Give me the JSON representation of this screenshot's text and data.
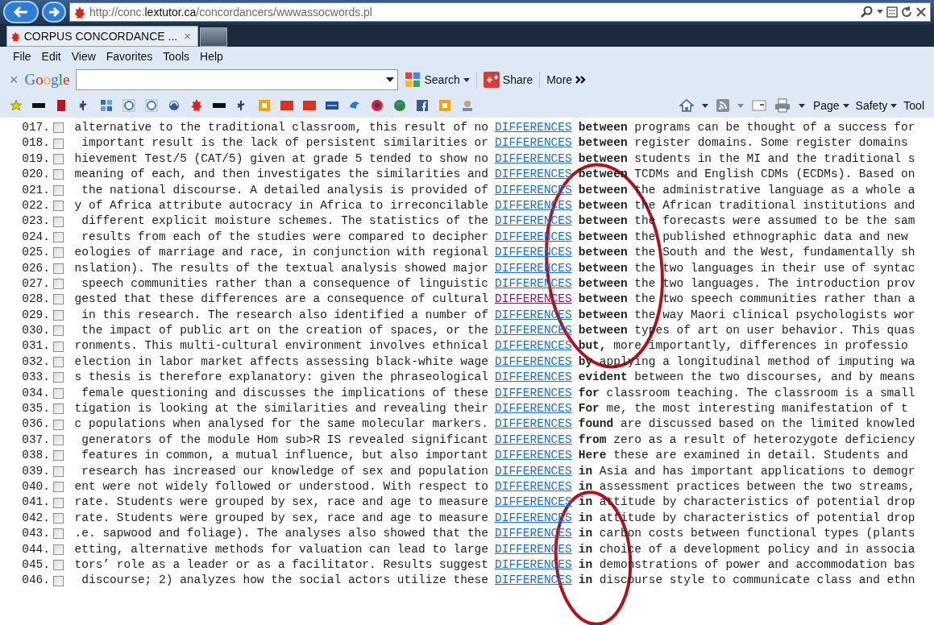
{
  "address_bar": {
    "url": "http://conc.**lextutor.ca**/concordancers/wwwassocwords.pl"
  },
  "tab": {
    "title": "CORPUS CONCORDANCE ...",
    "close": "×"
  },
  "menu": [
    "File",
    "Edit",
    "View",
    "Favorites",
    "Tools",
    "Help"
  ],
  "google_toolbar": {
    "close": "×",
    "logo": "Google",
    "search_button": "Search",
    "share_button": "Share",
    "more_button": "More"
  },
  "command_bar": [
    "Page",
    "Safety",
    "Tool"
  ],
  "rows": [
    {
      "num": "017.",
      "checked": false,
      "left": "alternative to the traditional classroom, this result of no",
      "keyword": "DIFFERENCES",
      "visited": false,
      "right": "**between** programs can be thought of a success for"
    },
    {
      "num": "018.",
      "checked": false,
      "left": " important result is the lack of persistent similarities or",
      "keyword": "DIFFERENCES",
      "visited": false,
      "right": "**between** register domains. Some register domains"
    },
    {
      "num": "019.",
      "checked": false,
      "left": "hievement Test/5 (CAT/5) given at grade 5 tended to show no",
      "keyword": "DIFFERENCES",
      "visited": false,
      "right": "**between** students in the MI and the traditional s"
    },
    {
      "num": "020.",
      "checked": false,
      "left": "meaning of each, and then investigates the similarities and",
      "keyword": "DIFFERENCES",
      "visited": false,
      "right": "**between** TCDMs and English CDMs (ECDMs). Based on"
    },
    {
      "num": "021.",
      "checked": false,
      "left": " the national discourse. A detailed analysis is provided of",
      "keyword": "DIFFERENCES",
      "visited": false,
      "right": "**between** the administrative language as a whole a"
    },
    {
      "num": "022.",
      "checked": false,
      "left": "y of Africa attribute autocracy in Africa to irreconcilable",
      "keyword": "DIFFERENCES",
      "visited": false,
      "right": "**between** the African traditional institutions and"
    },
    {
      "num": "023.",
      "checked": false,
      "left": " different explicit moisture schemes. The statistics of the",
      "keyword": "DIFFERENCES",
      "visited": false,
      "right": "**between** the forecasts were assumed to be the sam"
    },
    {
      "num": "024.",
      "checked": false,
      "left": " results from each of the studies were compared to decipher",
      "keyword": "DIFFERENCES",
      "visited": false,
      "right": "**between** the published ethnographic data and new"
    },
    {
      "num": "025.",
      "checked": false,
      "left": "eologies of marriage and race, in conjunction with regional",
      "keyword": "DIFFERENCES",
      "visited": false,
      "right": "**between** the South and the West, fundamentally sh"
    },
    {
      "num": "026.",
      "checked": false,
      "left": "nslation). The results of the textual analysis showed major",
      "keyword": "DIFFERENCES",
      "visited": false,
      "right": "**between** the two languages in their use of syntac"
    },
    {
      "num": "027.",
      "checked": false,
      "left": " speech communities rather than a consequence of linguistic",
      "keyword": "DIFFERENCES",
      "visited": false,
      "right": "**between** the two languages. The introduction prov"
    },
    {
      "num": "028.",
      "checked": false,
      "left": "gested that these differences are a consequence of cultural",
      "keyword": "DIFFERENCES",
      "visited": true,
      "right": "**between** the two speech communities rather than a"
    },
    {
      "num": "029.",
      "checked": false,
      "left": " in this research. The research also identified a number of",
      "keyword": "DIFFERENCES",
      "visited": false,
      "right": "**between** the way Maori clinical psychologists wor"
    },
    {
      "num": "030.",
      "checked": false,
      "left": " the impact of public art on the creation of spaces, or the",
      "keyword": "DIFFERENCES",
      "visited": false,
      "right": "**between** types of art on user behavior. This quas"
    },
    {
      "num": "031.",
      "checked": false,
      "left": "ronments. This multi-cultural environment involves ethnical",
      "keyword": "DIFFERENCES",
      "visited": false,
      "right": "**but,** more importantly, differences in professio"
    },
    {
      "num": "032.",
      "checked": false,
      "left": "election in labor market affects assessing black-white wage",
      "keyword": "DIFFERENCES",
      "visited": false,
      "right": "**by** applying a longitudinal method of imputing wa"
    },
    {
      "num": "033.",
      "checked": false,
      "left": "s thesis is therefore explanatory: given the phraseological",
      "keyword": "DIFFERENCES",
      "visited": false,
      "right": "**evident** between the two discourses, and by means"
    },
    {
      "num": "034.",
      "checked": false,
      "left": " female questioning and discusses the implications of these",
      "keyword": "DIFFERENCES",
      "visited": false,
      "right": "**for** classroom teaching. The classroom is a small"
    },
    {
      "num": "035.",
      "checked": false,
      "left": "tigation is looking at the similarities and revealing their",
      "keyword": "DIFFERENCES",
      "visited": false,
      "right": "**For** me, the most interesting manifestation of t"
    },
    {
      "num": "036.",
      "checked": false,
      "left": "c populations when analysed for the same molecular markers.",
      "keyword": "DIFFERENCES",
      "visited": false,
      "right": "**found** are discussed based on the limited knowled"
    },
    {
      "num": "037.",
      "checked": false,
      "left": " generators of the module Hom sub>R IS revealed significant",
      "keyword": "DIFFERENCES",
      "visited": false,
      "right": "**from** zero as a result of heterozygote deficiency"
    },
    {
      "num": "038.",
      "checked": false,
      "left": " features in common, a mutual influence, but also important",
      "keyword": "DIFFERENCES",
      "visited": false,
      "right": "**Here** these are examined in detail. Students and"
    },
    {
      "num": "039.",
      "checked": false,
      "left": " research has increased our knowledge of sex and population",
      "keyword": "DIFFERENCES",
      "visited": false,
      "right": "**in** Asia and has important applications to demogr"
    },
    {
      "num": "040.",
      "checked": false,
      "left": "ent were not widely followed or understood. With respect to",
      "keyword": "DIFFERENCES",
      "visited": false,
      "right": "**in** assessment practices between the two streams,"
    },
    {
      "num": "041.",
      "checked": false,
      "left": "rate. Students were grouped by sex, race and age to measure",
      "keyword": "DIFFERENCES",
      "visited": false,
      "right": "**in** attitude by characteristics of potential drop"
    },
    {
      "num": "042.",
      "checked": false,
      "left": "rate. Students were grouped by sex, race and age to measure",
      "keyword": "DIFFERENCES",
      "visited": false,
      "right": "**in** attitude by characteristics of potential drop"
    },
    {
      "num": "043.",
      "checked": false,
      "left": ".e. sapwood and foliage). The analyses also showed that the",
      "keyword": "DIFFERENCES",
      "visited": false,
      "right": "**in** carbon costs between functional types (plants"
    },
    {
      "num": "044.",
      "checked": false,
      "left": "etting, alternative methods for valuation can lead to large",
      "keyword": "DIFFERENCES",
      "visited": false,
      "right": "**in** choice of a development policy and in associa"
    },
    {
      "num": "045.",
      "checked": false,
      "left": "tors’ role as a leader or as a facilitator. Results suggest",
      "keyword": "DIFFERENCES",
      "visited": false,
      "right": "**in** demonstrations of power and accommodation bas"
    },
    {
      "num": "046.",
      "checked": false,
      "left": " discourse; 2) analyzes how the social actors utilize these",
      "keyword": "DIFFERENCES",
      "visited": false,
      "right": "**in** discourse style to communicate class and ethn"
    }
  ]
}
